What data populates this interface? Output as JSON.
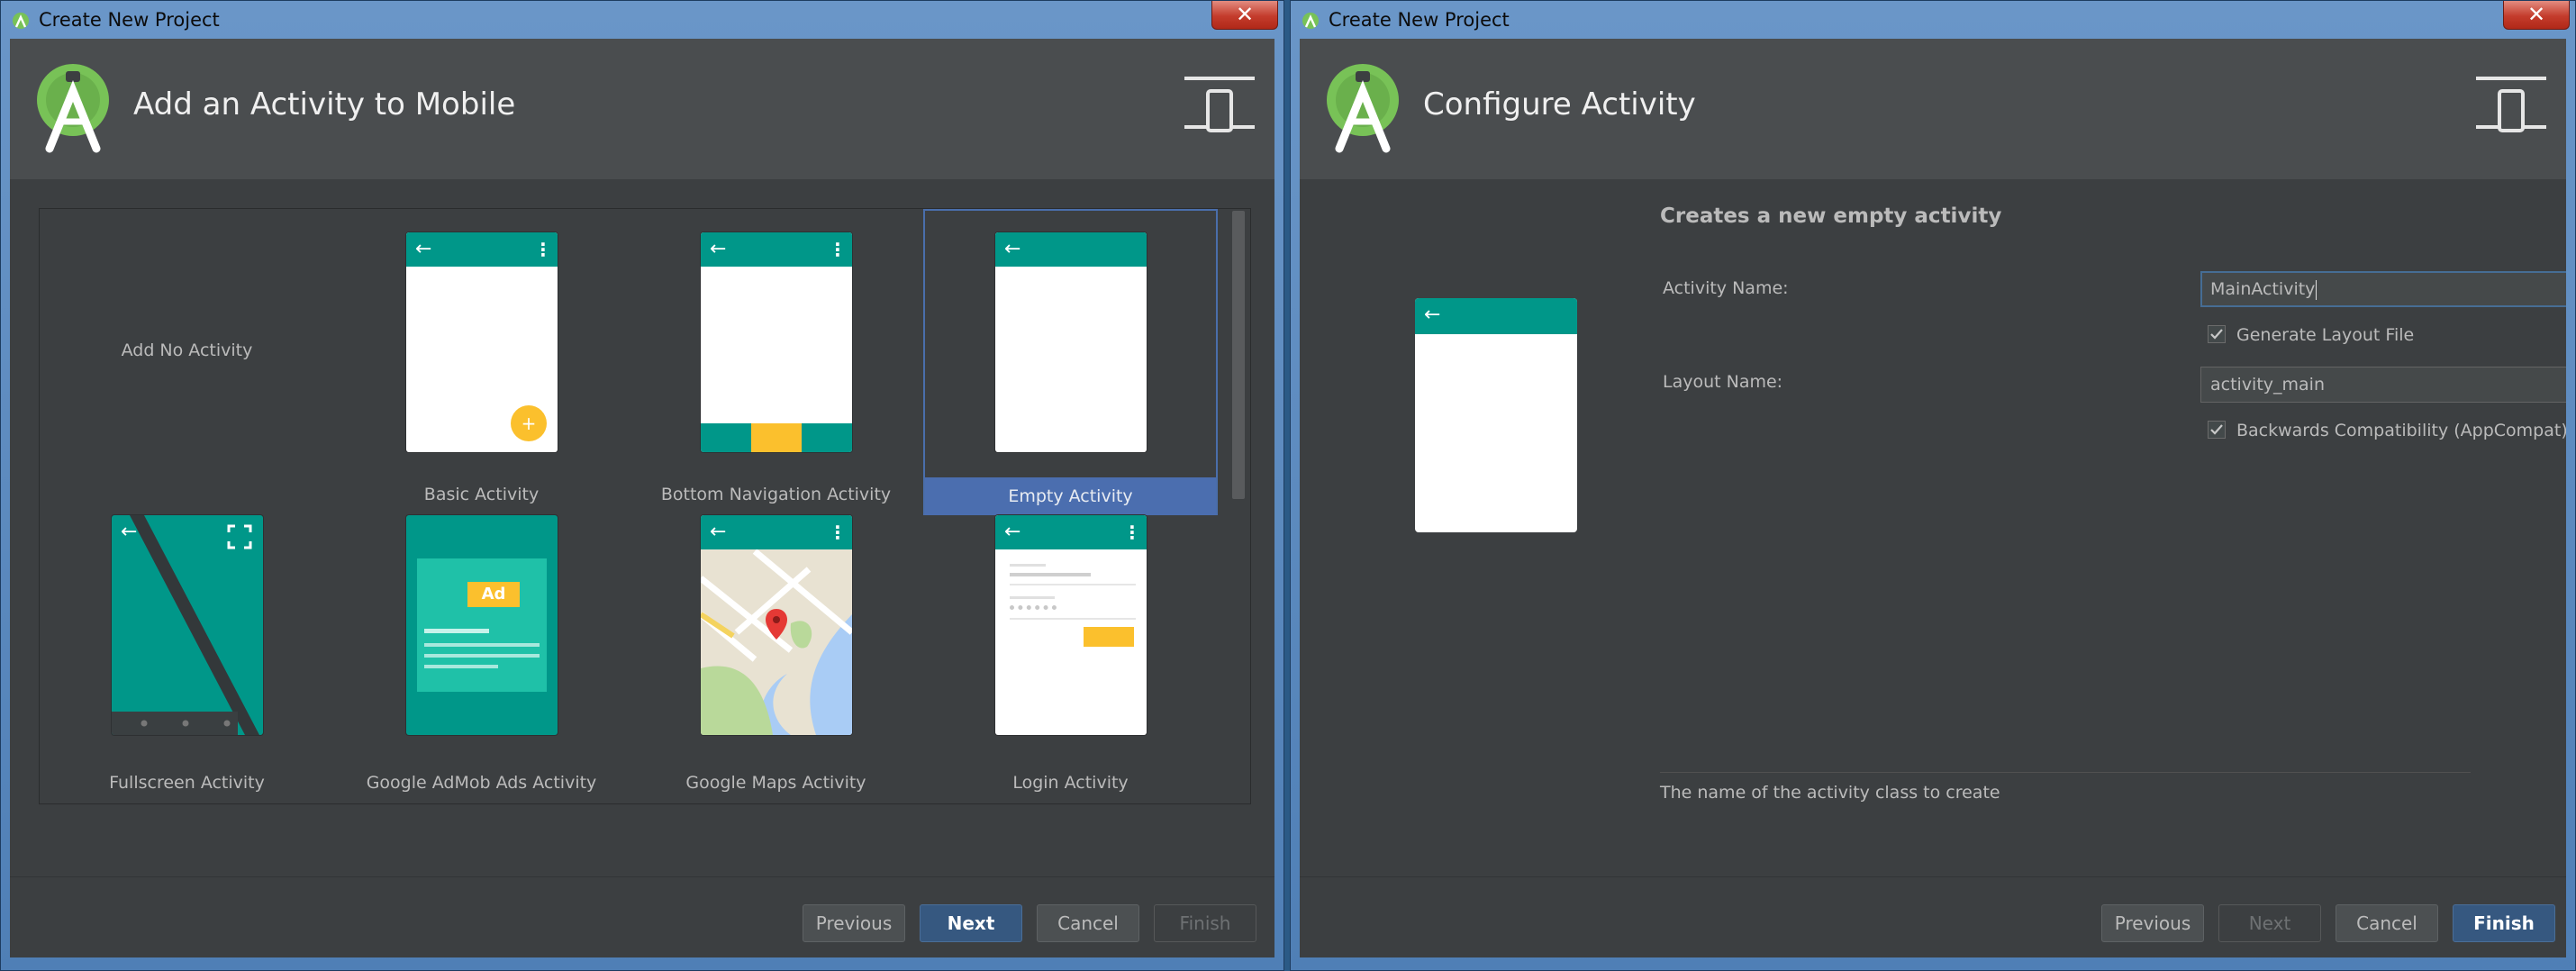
{
  "left_window": {
    "title": "Create New Project",
    "close": "✕",
    "header_title": "Add an Activity to Mobile",
    "no_activity": "Add No Activity",
    "tiles": {
      "basic": "Basic Activity",
      "bottom_nav": "Bottom Navigation Activity",
      "empty": "Empty Activity",
      "fullscreen": "Fullscreen Activity",
      "admob": "Google AdMob Ads Activity",
      "maps": "Google Maps Activity",
      "login": "Login Activity"
    },
    "ad_badge": "Ad",
    "fab": "+",
    "buttons": {
      "previous": "Previous",
      "next": "Next",
      "cancel": "Cancel",
      "finish": "Finish"
    }
  },
  "right_window": {
    "title": "Create New Project",
    "close": "✕",
    "header_title": "Configure Activity",
    "heading": "Creates a new empty activity",
    "activity_name_label": "Activity Name:",
    "activity_name_value": "MainActivity",
    "generate_layout_label": "Generate Layout File",
    "layout_name_label": "Layout Name:",
    "layout_name_value": "activity_main",
    "backwards_label": "Backwards Compatibility (AppCompat)",
    "hint": "The name of the activity class to create",
    "buttons": {
      "previous": "Previous",
      "next": "Next",
      "cancel": "Cancel",
      "finish": "Finish"
    }
  },
  "icons": {
    "arrow": "←",
    "dots": "⋮"
  },
  "colors": {
    "header_bg": "#4a4d4f",
    "dialog_bg": "#3c3f41",
    "teal": "#009789",
    "selection": "#4b6eaf",
    "accent_yellow": "#fbc02d"
  }
}
